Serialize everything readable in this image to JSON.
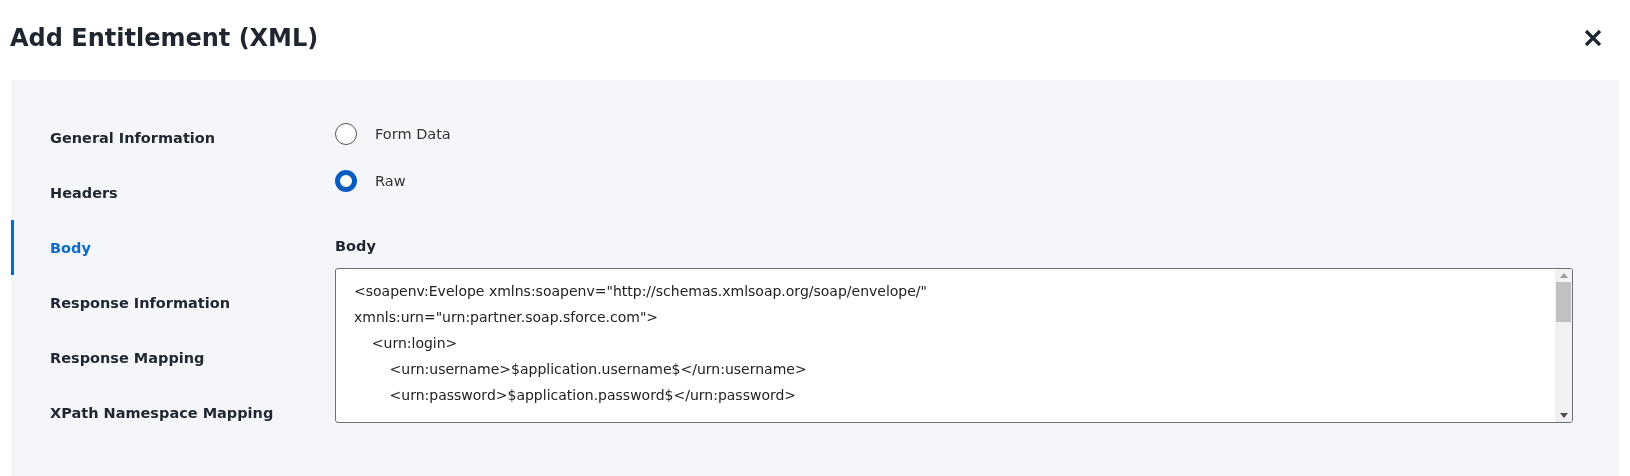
{
  "dialog": {
    "title": "Add Entitlement (XML)"
  },
  "sidebar": {
    "items": [
      {
        "label": "General Information",
        "selected": false
      },
      {
        "label": "Headers",
        "selected": false
      },
      {
        "label": "Body",
        "selected": true
      },
      {
        "label": "Response Information",
        "selected": false
      },
      {
        "label": "Response Mapping",
        "selected": false
      },
      {
        "label": "XPath Namespace Mapping",
        "selected": false
      }
    ]
  },
  "body_type": {
    "options": [
      {
        "label": "Form Data",
        "selected": false
      },
      {
        "label": "Raw",
        "selected": true
      }
    ]
  },
  "body_field": {
    "label": "Body",
    "lines": [
      "<soapenv:Evelope xmlns:soapenv=\"http://schemas.xmlsoap.org/soap/envelope/\"",
      "xmnls:urn=\"urn:partner.soap.sforce.com\">",
      "    <urn:login>",
      "        <urn:username>$application.username$</urn:username>",
      "        <urn:password>$application.password$</urn:password>"
    ]
  }
}
